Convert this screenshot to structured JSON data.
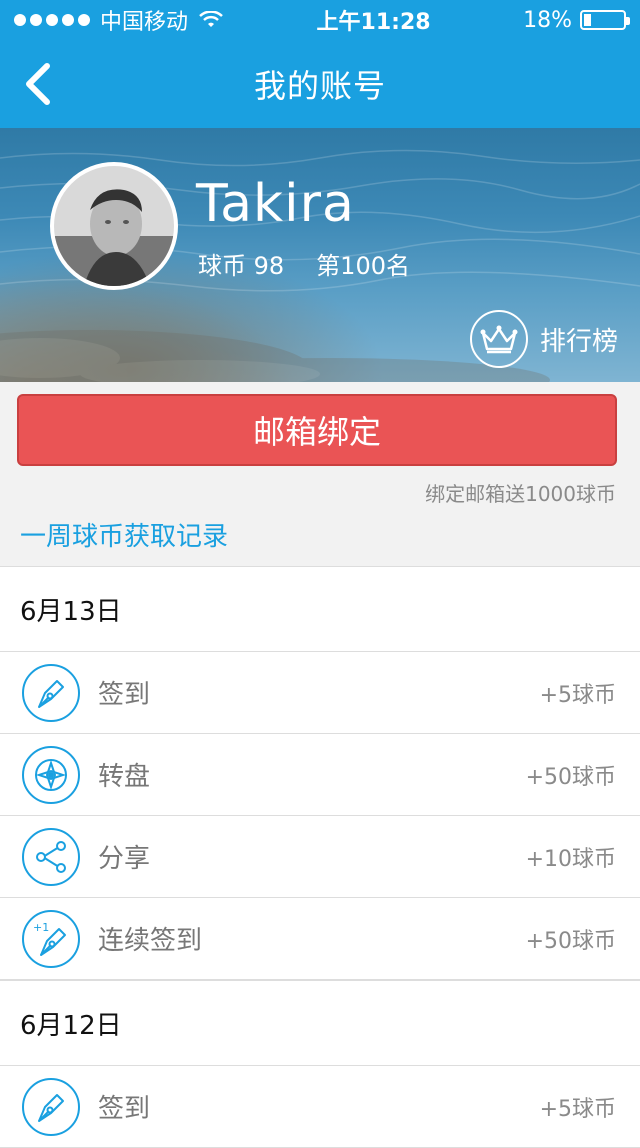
{
  "status_bar": {
    "carrier": "中国移动",
    "time": "上午11:28",
    "battery": "18%",
    "battery_level": 0.18
  },
  "nav": {
    "title": "我的账号",
    "back_icon": "chevron-left-icon"
  },
  "profile": {
    "username": "Takira",
    "coins_label": "球币 98",
    "rank_label": "第100名",
    "ranking_button": "排行榜",
    "ranking_icon": "crown-icon"
  },
  "actions": {
    "bind_email_button": "邮箱绑定",
    "bonus_hint": "绑定邮箱送1000球币",
    "weekly_record_link": "一周球币获取记录"
  },
  "records": [
    {
      "date": "6月13日",
      "items": [
        {
          "label": "签到",
          "points": "+5球币",
          "icon": "pen-nib-icon"
        },
        {
          "label": "转盘",
          "points": "+50球币",
          "icon": "wheel-icon"
        },
        {
          "label": "分享",
          "points": "+10球币",
          "icon": "share-icon"
        },
        {
          "label": "连续签到",
          "points": "+50球币",
          "icon": "pen-nib-plus-one-icon"
        }
      ]
    },
    {
      "date": "6月12日",
      "items": [
        {
          "label": "签到",
          "points": "+5球币",
          "icon": "pen-nib-icon"
        }
      ]
    }
  ],
  "colors": {
    "accent": "#1aa0e0",
    "button_red": "#ea5455"
  }
}
